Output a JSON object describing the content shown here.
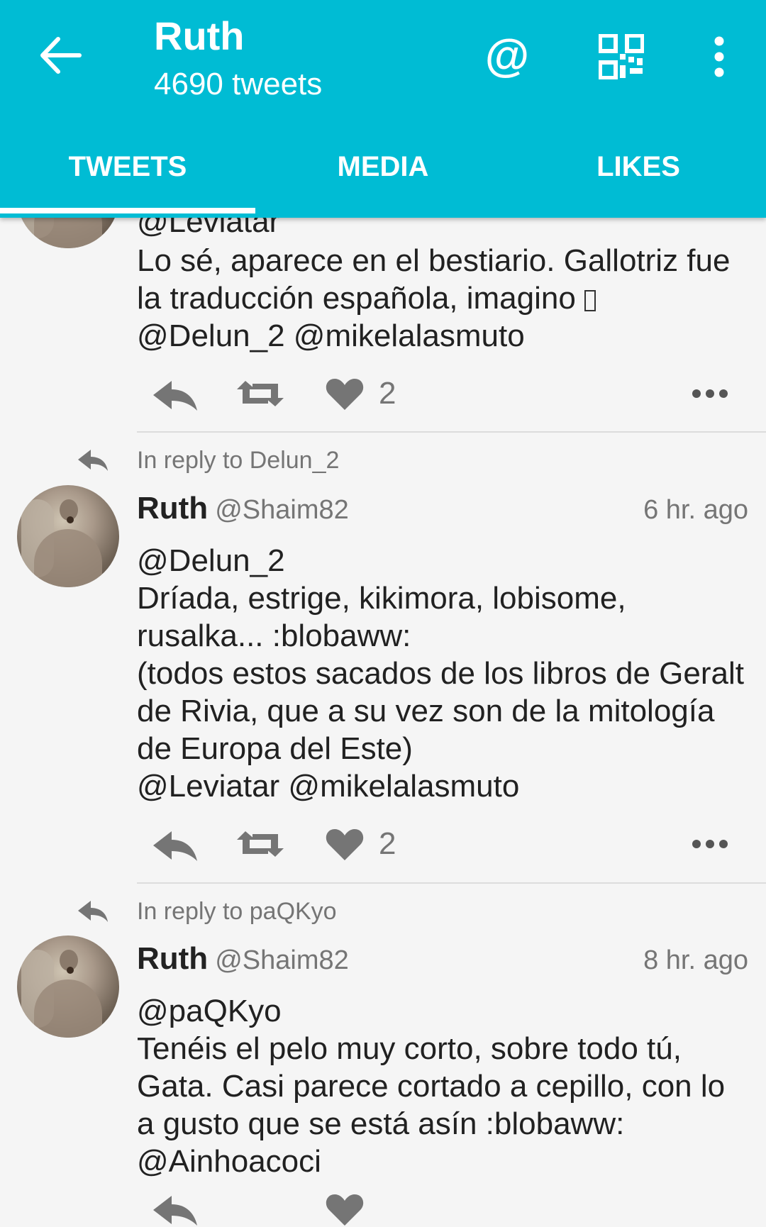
{
  "appbar": {
    "title": "Ruth",
    "subtitle": "4690 tweets",
    "at_symbol": "@",
    "icons": [
      "back-arrow-icon",
      "mention-icon",
      "qr-code-icon",
      "more-vert-icon"
    ]
  },
  "tabs": [
    {
      "label": "TWEETS",
      "selected": true
    },
    {
      "label": "MEDIA",
      "selected": false
    },
    {
      "label": "LIKES",
      "selected": false
    }
  ],
  "colors": {
    "primary": "#00bcd4",
    "action_gray": "#757575",
    "background": "#f5f5f5"
  },
  "tweets": [
    {
      "partial_top_text": "@Leviatar",
      "body": "Lo sé, aparece en el bestiario. Gallotriz fue la traducción española, imagino ",
      "mentions": "@Delun_2 @mikelalasmuto",
      "likes": "2"
    },
    {
      "reply_to": "In reply to Delun_2",
      "name": "Ruth",
      "username": "@Shaim82",
      "time": "6 hr. ago",
      "body": "@Delun_2\nDríada, estrige, kikimora, lobisome, rusalka... :blobaww:\n(todos estos sacados de los libros de Geralt de Rivia, que a su vez son de la mitología de Europa del Este)\n@Leviatar @mikelalasmuto",
      "likes": "2"
    },
    {
      "reply_to": "In reply to paQKyo",
      "name": "Ruth",
      "username": "@Shaim82",
      "time": "8 hr. ago",
      "body": "@paQKyo\nTenéis el pelo muy corto, sobre todo tú, Gata. Casi parece cortado a cepillo, con lo a gusto que se está asín :blobaww:\n@Ainhoacoci"
    }
  ]
}
